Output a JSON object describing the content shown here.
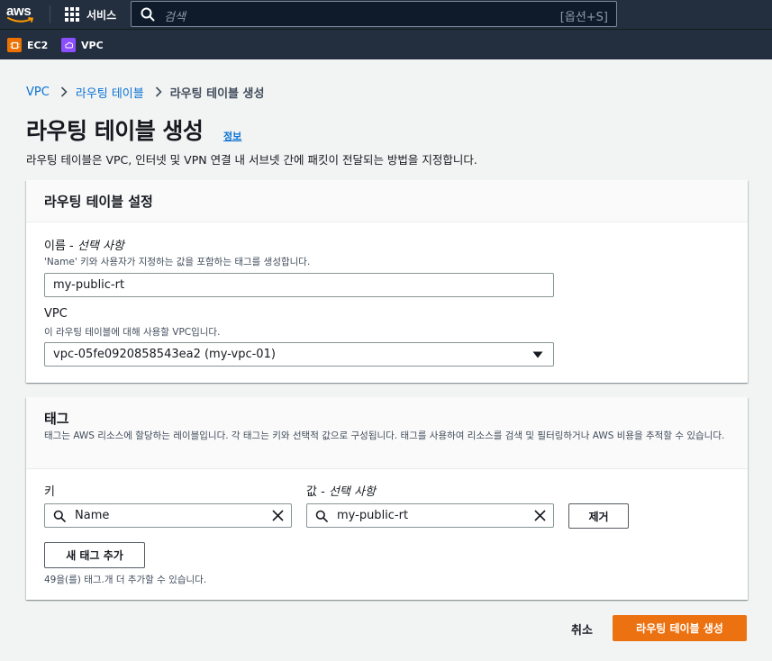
{
  "topnav": {
    "logo_text": "aws",
    "services_label": "서비스",
    "search_placeholder": "검색",
    "search_shortcut": "[옵션+S]"
  },
  "favorites": [
    {
      "label": "EC2",
      "color": "#ed7100"
    },
    {
      "label": "VPC",
      "color": "#8c4fff"
    }
  ],
  "breadcrumb": [
    "VPC",
    "라우팅 테이블",
    "라우팅 테이블 생성"
  ],
  "page": {
    "title": "라우팅 테이블 생성",
    "info_link": "정보",
    "description": "라우팅 테이블은 VPC, 인터넷 및 VPN 연결 내 서브넷 간에 패킷이 전달되는 방법을 지정합니다."
  },
  "settings_panel": {
    "title": "라우팅 테이블 설정",
    "name_label": "이름 -",
    "name_optional": "선택 사항",
    "name_hint": "'Name' 키와 사용자가 지정하는 값을 포함하는 태그를 생성합니다.",
    "name_value": "my-public-rt",
    "vpc_label": "VPC",
    "vpc_hint": "이 라우팅 테이블에 대해 사용할 VPC입니다.",
    "vpc_value": "vpc-05fe0920858543ea2 (my-vpc-01)"
  },
  "tags_panel": {
    "title": "태그",
    "description": "태그는 AWS 리소스에 할당하는 레이블입니다. 각 태그는 키와 선택적 값으로 구성됩니다. 태그를 사용하여 리소스를 검색 및 필터링하거나 AWS 비용을 추적할 수 있습니다.",
    "key_label": "키",
    "value_label": "값 -",
    "value_optional": "선택 사항",
    "key_value": "Name",
    "value_value": "my-public-rt",
    "remove_button": "제거",
    "add_button": "새 태그 추가",
    "remaining_hint": "49을(를) 태그.개 더 추가할 수 있습니다."
  },
  "footer": {
    "cancel_label": "취소",
    "submit_label": "라우팅 테이블 생성"
  },
  "colors": {
    "nav_bg": "#232f3e",
    "link": "#0972d3",
    "primary": "#ec7211"
  }
}
